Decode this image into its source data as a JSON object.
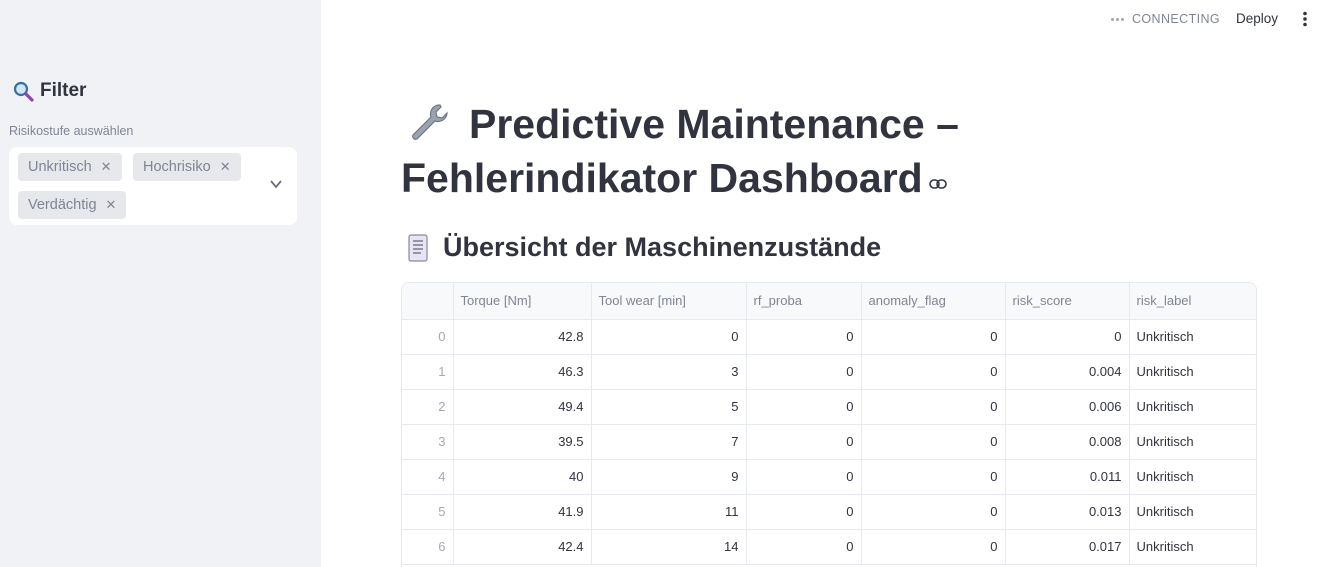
{
  "sidebar": {
    "header": "Filter",
    "select_label": "Risikostufe auswählen",
    "chips": [
      "Unkritisch",
      "Hochrisiko",
      "Verdächtig"
    ]
  },
  "topbar": {
    "status": "CONNECTING",
    "deploy": "Deploy"
  },
  "main": {
    "title": "Predictive Maintenance – Fehlerindikator Dashboard",
    "section_title": "Übersicht der Maschinenzustände"
  },
  "table": {
    "columns": [
      "",
      "Torque [Nm]",
      "Tool wear [min]",
      "rf_proba",
      "anomaly_flag",
      "risk_score",
      "risk_label"
    ],
    "rows": [
      [
        "0",
        "42.8",
        "0",
        "0",
        "0",
        "0",
        "Unkritisch"
      ],
      [
        "1",
        "46.3",
        "3",
        "0",
        "0",
        "0.004",
        "Unkritisch"
      ],
      [
        "2",
        "49.4",
        "5",
        "0",
        "0",
        "0.006",
        "Unkritisch"
      ],
      [
        "3",
        "39.5",
        "7",
        "0",
        "0",
        "0.008",
        "Unkritisch"
      ],
      [
        "4",
        "40",
        "9",
        "0",
        "0",
        "0.011",
        "Unkritisch"
      ],
      [
        "5",
        "41.9",
        "11",
        "0",
        "0",
        "0.013",
        "Unkritisch"
      ],
      [
        "6",
        "42.4",
        "14",
        "0",
        "0",
        "0.017",
        "Unkritisch"
      ]
    ]
  }
}
